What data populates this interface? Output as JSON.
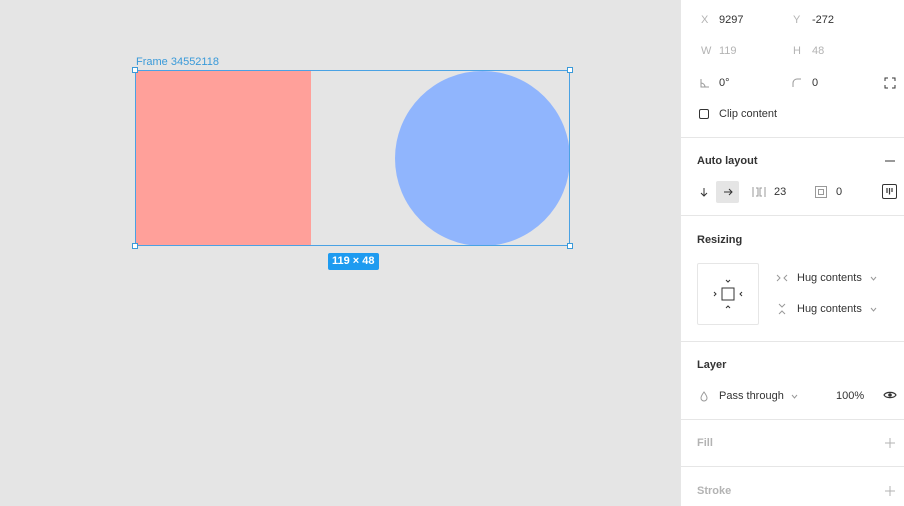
{
  "canvas": {
    "frame_name": "Frame 34552118",
    "size_badge": "119 × 48",
    "colors": {
      "rect": "#ffa09a",
      "circle": "#90b5fd",
      "selection": "#3a9ad9"
    }
  },
  "panel": {
    "position": {
      "x_label": "X",
      "x_value": "9297",
      "y_label": "Y",
      "y_value": "-272"
    },
    "dimensions": {
      "w_label": "W",
      "w_value": "119",
      "h_label": "H",
      "h_value": "48"
    },
    "transform": {
      "rotation_value": "0°",
      "radius_value": "0"
    },
    "clip_content_label": "Clip content",
    "auto_layout": {
      "title": "Auto layout",
      "spacing_value": "23",
      "padding_value": "0"
    },
    "resizing": {
      "title": "Resizing",
      "horizontal": "Hug contents",
      "vertical": "Hug contents"
    },
    "layer": {
      "title": "Layer",
      "blend_mode": "Pass through",
      "opacity": "100%"
    },
    "fill_title": "Fill",
    "stroke_title": "Stroke"
  }
}
